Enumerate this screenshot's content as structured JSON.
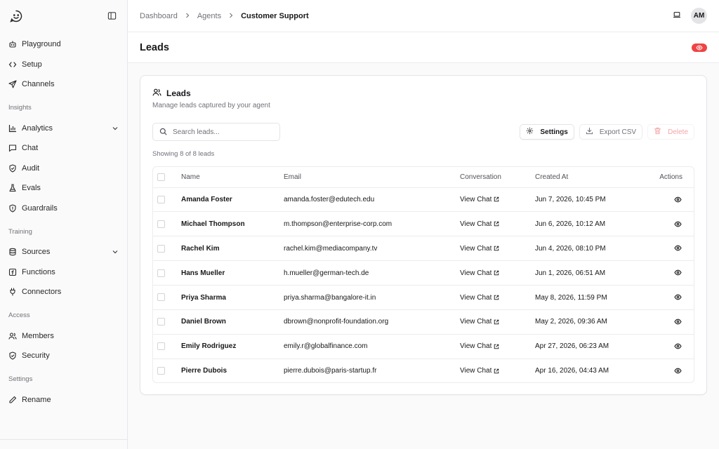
{
  "sidebar": {
    "items_top": [
      {
        "label": "Playground",
        "icon": "bot-icon"
      },
      {
        "label": "Setup",
        "icon": "code-icon"
      },
      {
        "label": "Channels",
        "icon": "send-icon"
      }
    ],
    "sections": [
      {
        "title": "Insights",
        "items": [
          {
            "label": "Analytics",
            "icon": "bar-chart-icon",
            "expandable": true
          },
          {
            "label": "Chat",
            "icon": "message-icon"
          },
          {
            "label": "Audit",
            "icon": "shield-check-icon"
          },
          {
            "label": "Evals",
            "icon": "flask-icon"
          },
          {
            "label": "Guardrails",
            "icon": "shield-alert-icon"
          }
        ]
      },
      {
        "title": "Training",
        "items": [
          {
            "label": "Sources",
            "icon": "database-icon",
            "expandable": true
          },
          {
            "label": "Functions",
            "icon": "function-icon"
          },
          {
            "label": "Connectors",
            "icon": "plug-icon"
          }
        ]
      },
      {
        "title": "Access",
        "items": [
          {
            "label": "Members",
            "icon": "users-icon"
          },
          {
            "label": "Security",
            "icon": "shield-icon"
          }
        ]
      },
      {
        "title": "Settings",
        "items": [
          {
            "label": "Rename",
            "icon": "pencil-icon"
          }
        ]
      }
    ]
  },
  "header": {
    "breadcrumbs": [
      "Dashboard",
      "Agents",
      "Customer Support"
    ],
    "avatar_initials": "AM"
  },
  "page": {
    "title": "Leads",
    "status_color": "#ef4444"
  },
  "card": {
    "title": "Leads",
    "subtitle": "Manage leads captured by your agent",
    "search_placeholder": "Search leads...",
    "settings_label": "Settings",
    "export_label": "Export CSV",
    "delete_label": "Delete",
    "showing_text": "Showing 8 of 8 leads"
  },
  "table": {
    "columns": [
      "Name",
      "Email",
      "Conversation",
      "Created At",
      "Actions"
    ],
    "rows": [
      {
        "name": "Amanda Foster",
        "email": "amanda.foster@edutech.edu",
        "conversation": "View Chat",
        "created": "Jun 7, 2026, 10:45 PM"
      },
      {
        "name": "Michael Thompson",
        "email": "m.thompson@enterprise-corp.com",
        "conversation": "View Chat",
        "created": "Jun 6, 2026, 10:12 AM"
      },
      {
        "name": "Rachel Kim",
        "email": "rachel.kim@mediacompany.tv",
        "conversation": "View Chat",
        "created": "Jun 4, 2026, 08:10 PM"
      },
      {
        "name": "Hans Mueller",
        "email": "h.mueller@german-tech.de",
        "conversation": "View Chat",
        "created": "Jun 1, 2026, 06:51 AM"
      },
      {
        "name": "Priya Sharma",
        "email": "priya.sharma@bangalore-it.in",
        "conversation": "View Chat",
        "created": "May 8, 2026, 11:59 PM"
      },
      {
        "name": "Daniel Brown",
        "email": "dbrown@nonprofit-foundation.org",
        "conversation": "View Chat",
        "created": "May 2, 2026, 09:36 AM"
      },
      {
        "name": "Emily Rodriguez",
        "email": "emily.r@globalfinance.com",
        "conversation": "View Chat",
        "created": "Apr 27, 2026, 06:23 AM"
      },
      {
        "name": "Pierre Dubois",
        "email": "pierre.dubois@paris-startup.fr",
        "conversation": "View Chat",
        "created": "Apr 16, 2026, 04:43 AM"
      }
    ]
  }
}
